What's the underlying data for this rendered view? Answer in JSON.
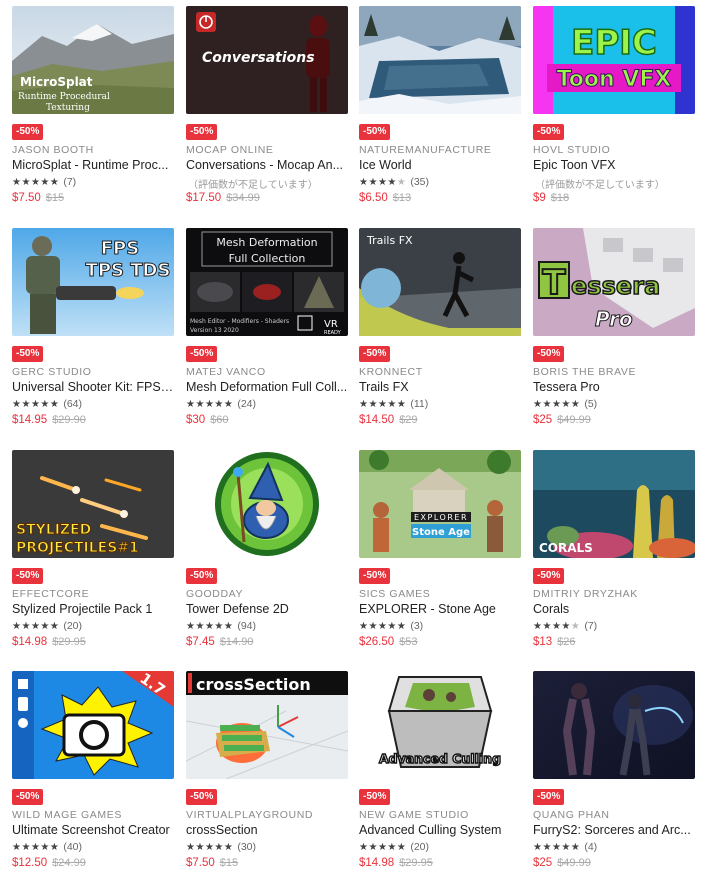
{
  "products": [
    {
      "id": "microsplat",
      "badge": "-50%",
      "publisher": "JASON BOOTH",
      "title": "MicroSplat - Runtime Proc...",
      "stars": 5,
      "count": "(7)",
      "no_rating": "",
      "price": "$7.50",
      "was": "$15",
      "thumb_text": [
        "MicroSplat",
        "Runtime Procedural",
        "Texturing"
      ]
    },
    {
      "id": "conversations",
      "badge": "-50%",
      "publisher": "MOCAP ONLINE",
      "title": "Conversations - Mocap An...",
      "stars": 0,
      "count": "",
      "no_rating": "（評価数が不足しています）",
      "price": "$17.50",
      "was": "$34.99",
      "thumb_text": [
        "Conversations"
      ]
    },
    {
      "id": "iceworld",
      "badge": "-50%",
      "publisher": "NATUREMANUFACTURE",
      "title": "Ice World",
      "stars": 4,
      "count": "(35)",
      "no_rating": "",
      "price": "$6.50",
      "was": "$13",
      "thumb_text": []
    },
    {
      "id": "epictoon",
      "badge": "-50%",
      "publisher": "HOVL STUDIO",
      "title": "Epic Toon VFX",
      "stars": 0,
      "count": "",
      "no_rating": "（評価数が不足しています）",
      "price": "$9",
      "was": "$18",
      "thumb_text": [
        "EPIC",
        "Toon VFX"
      ]
    },
    {
      "id": "shooterkit",
      "badge": "-50%",
      "publisher": "GERC STUDIO",
      "title": "Universal Shooter Kit: FPS,...",
      "stars": 5,
      "count": "(64)",
      "no_rating": "",
      "price": "$14.95",
      "was": "$29.90",
      "thumb_text": [
        "FPS",
        "TPS TDS"
      ]
    },
    {
      "id": "meshdeform",
      "badge": "-50%",
      "publisher": "MATEJ VANCO",
      "title": "Mesh Deformation Full Coll...",
      "stars": 5,
      "count": "(24)",
      "no_rating": "",
      "price": "$30",
      "was": "$60",
      "thumb_text": [
        "Mesh Deformation",
        "Full Collection",
        "Mesh Editor - Modifiers - Shaders",
        "Version 13 2020",
        "VR",
        "READY"
      ]
    },
    {
      "id": "trailsfx",
      "badge": "-50%",
      "publisher": "KRONNECT",
      "title": "Trails FX",
      "stars": 5,
      "count": "(11)",
      "no_rating": "",
      "price": "$14.50",
      "was": "$29",
      "thumb_text": [
        "Trails FX"
      ]
    },
    {
      "id": "tessera",
      "badge": "-50%",
      "publisher": "BORIS THE BRAVE",
      "title": "Tessera Pro",
      "stars": 5,
      "count": "(5)",
      "no_rating": "",
      "price": "$25",
      "was": "$49.99",
      "thumb_text": [
        "T",
        "essera",
        "Pro"
      ]
    },
    {
      "id": "projectiles",
      "badge": "-50%",
      "publisher": "EFFECTCORE",
      "title": "Stylized Projectile Pack 1",
      "stars": 5,
      "count": "(20)",
      "no_rating": "",
      "price": "$14.98",
      "was": "$29.95",
      "thumb_text": [
        "STYLIZED",
        "PROJECTILES#1"
      ]
    },
    {
      "id": "towerdef",
      "badge": "-50%",
      "publisher": "GOODDAY",
      "title": "Tower Defense 2D",
      "stars": 5,
      "count": "(94)",
      "no_rating": "",
      "price": "$7.45",
      "was": "$14.90",
      "thumb_text": []
    },
    {
      "id": "explorer",
      "badge": "-50%",
      "publisher": "SICS GAMES",
      "title": "EXPLORER - Stone Age",
      "stars": 5,
      "count": "(3)",
      "no_rating": "",
      "price": "$26.50",
      "was": "$53",
      "thumb_text": [
        "EXPLORER",
        "Stone Age"
      ]
    },
    {
      "id": "corals",
      "badge": "-50%",
      "publisher": "DMITRIY DRYZHAK",
      "title": "Corals",
      "stars": 4,
      "count": "(7)",
      "no_rating": "",
      "price": "$13",
      "was": "$26",
      "thumb_text": [
        "CORALS"
      ]
    },
    {
      "id": "screenshot",
      "badge": "-50%",
      "publisher": "WILD MAGE GAMES",
      "title": "Ultimate Screenshot Creator",
      "stars": 5,
      "count": "(40)",
      "no_rating": "",
      "price": "$12.50",
      "was": "$24.99",
      "thumb_text": [
        "1.7"
      ]
    },
    {
      "id": "crosssection",
      "badge": "-50%",
      "publisher": "VIRTUALPLAYGROUND",
      "title": "crossSection",
      "stars": 5,
      "count": "(30)",
      "no_rating": "",
      "price": "$7.50",
      "was": "$15",
      "thumb_text": [
        "crossSection"
      ]
    },
    {
      "id": "culling",
      "badge": "-50%",
      "publisher": "NEW GAME STUDIO",
      "title": "Advanced Culling System",
      "stars": 5,
      "count": "(20)",
      "no_rating": "",
      "price": "$14.98",
      "was": "$29.95",
      "thumb_text": [
        "Advanced Culling"
      ]
    },
    {
      "id": "furrys2",
      "badge": "-50%",
      "publisher": "QUANG PHAN",
      "title": "FurryS2: Sorceres and Arc...",
      "stars": 5,
      "count": "(4)",
      "no_rating": "",
      "price": "$25",
      "was": "$49.99",
      "thumb_text": []
    }
  ],
  "colors": {
    "sale_badge": "#e8323c",
    "sale_price": "#e8323c",
    "old_price": "#aaaaaa",
    "publisher": "#8a8a8a",
    "star": "#444444"
  },
  "icons": {
    "star_full": "★",
    "star_empty": "☆"
  }
}
